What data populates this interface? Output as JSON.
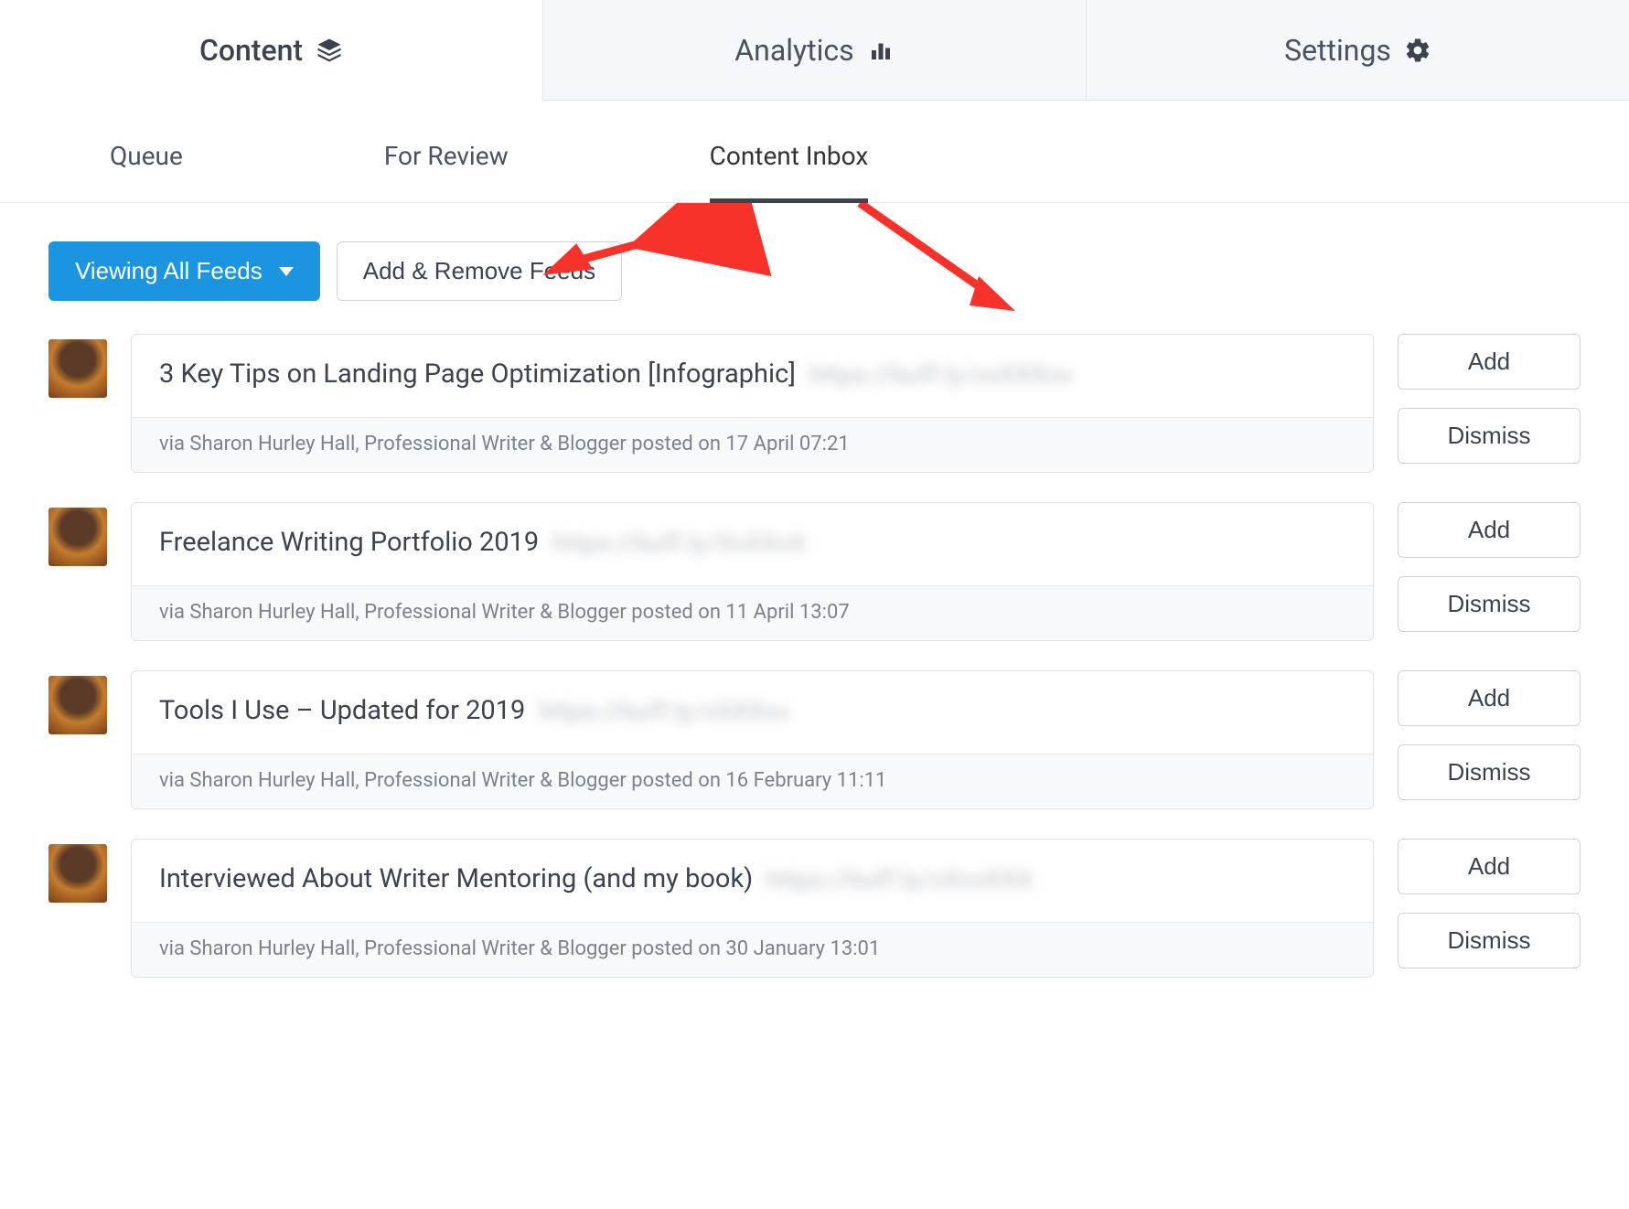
{
  "main_tabs": {
    "content": "Content",
    "analytics": "Analytics",
    "settings": "Settings"
  },
  "sub_tabs": {
    "queue": "Queue",
    "for_review": "For Review",
    "content_inbox": "Content Inbox"
  },
  "controls": {
    "viewing_all_feeds": "Viewing All Feeds",
    "add_remove_feeds": "Add & Remove Feeds"
  },
  "action_labels": {
    "add": "Add",
    "dismiss": "Dismiss"
  },
  "items": [
    {
      "title": "3 Key Tips on Landing Page Optimization [Infographic]",
      "link_blurred": "https://buff.ly/xxXXXxx",
      "meta": "via Sharon Hurley Hall, Professional Writer & Blogger posted on 17 April 07:21"
    },
    {
      "title": "Freelance Writing Portfolio 2019",
      "link_blurred": "https://buff.ly/XxXXxX",
      "meta": "via Sharon Hurley Hall, Professional Writer & Blogger posted on 11 April 13:07"
    },
    {
      "title": "Tools I Use – Updated for 2019",
      "link_blurred": "https://buff.ly/xXXXxx",
      "meta": "via Sharon Hurley Hall, Professional Writer & Blogger posted on 16 February 11:11"
    },
    {
      "title": "Interviewed About Writer Mentoring (and my book)",
      "link_blurred": "https://buff.ly/xXxxXXX",
      "meta": "via Sharon Hurley Hall, Professional Writer & Blogger posted on 30 January 13:01"
    }
  ]
}
